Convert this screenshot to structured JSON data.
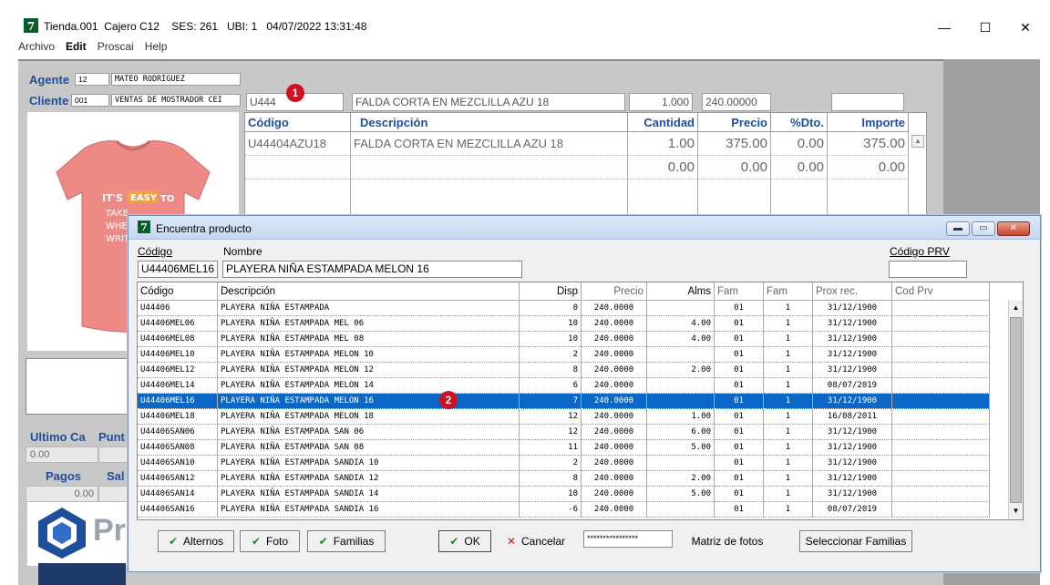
{
  "window": {
    "app_icon": "7",
    "title": "Tienda.001  Cajero C12    SES: 261   UBI: 1   04/07/2022 13:31:48",
    "minimize": "—",
    "maximize": "☐",
    "close": "✕"
  },
  "menu": [
    "Archivo",
    "Edit",
    "Proscai",
    "Help"
  ],
  "customer": {
    "agente_label": "Agente",
    "agente_code": "12",
    "agente_name": "MATEO RODRIGUEZ",
    "cliente_label": "Cliente",
    "cliente_code": "001",
    "cliente_name": "VENTAS DE MOSTRADOR CEI"
  },
  "entry": {
    "code": "U444",
    "description": "FALDA CORTA EN MEZCLILLA AZU 18",
    "quantity": "1.000",
    "price": "240.00000",
    "extra": ""
  },
  "order_grid": {
    "headers": [
      "Código",
      "Descripción",
      "Cantidad",
      "Precio",
      "%Dto.",
      "Importe"
    ],
    "rows": [
      [
        "U44404AZU18",
        "FALDA CORTA EN MEZCLILLA AZU 18",
        "1.00",
        "375.00",
        "0.00",
        "375.00"
      ],
      [
        "",
        "",
        "0.00",
        "0.00",
        "0.00",
        "0.00"
      ]
    ]
  },
  "side": {
    "ultimo_label": "Ultimo Ca",
    "punto_label": "Punt",
    "ultimo_value": "0.00",
    "pagos_label": "Pagos",
    "saldo_label": "Sal",
    "pagos_value": "0.00",
    "logo_text": "Pr"
  },
  "dialog": {
    "icon": "7",
    "title": "Encuentra producto",
    "codigo_label": "Código",
    "nombre_label": "Nombre",
    "codigo_prv_label": "Código PRV",
    "codigo_value": "U44406MEL16",
    "nombre_value": "PLAYERA NIÑA ESTAMPADA MELON 16",
    "codigo_prv_value": "",
    "columns": [
      "Código",
      "Descripción",
      "Disp",
      "Precio",
      "Alms",
      "Fam",
      "Fam",
      "Prox rec.",
      "Cod Prv"
    ],
    "rows": [
      [
        "U44406",
        "PLAYERA NIÑA ESTAMPADA",
        "0",
        "240.0000",
        "",
        "01",
        "1",
        "31/12/1900",
        ""
      ],
      [
        "U44406MEL06",
        "PLAYERA NIÑA ESTAMPADA MEL 06",
        "10",
        "240.0000",
        "4.00",
        "01",
        "1",
        "31/12/1900",
        ""
      ],
      [
        "U44406MEL08",
        "PLAYERA NIÑA ESTAMPADA MEL 08",
        "10",
        "240.0000",
        "4.00",
        "01",
        "1",
        "31/12/1900",
        ""
      ],
      [
        "U44406MEL10",
        "PLAYERA NIÑA ESTAMPADA MELON 10",
        "2",
        "240.0000",
        "",
        "01",
        "1",
        "31/12/1900",
        ""
      ],
      [
        "U44406MEL12",
        "PLAYERA NIÑA ESTAMPADA MELON 12",
        "8",
        "240.0000",
        "2.00",
        "01",
        "1",
        "31/12/1900",
        ""
      ],
      [
        "U44406MEL14",
        "PLAYERA NIÑA ESTAMPADA MELON 14",
        "6",
        "240.0000",
        "",
        "01",
        "1",
        "08/07/2019",
        ""
      ],
      [
        "U44406MEL16",
        "PLAYERA NIÑA ESTAMPADA MELON 16",
        "7",
        "240.0000",
        "",
        "01",
        "1",
        "31/12/1900",
        ""
      ],
      [
        "U44406MEL18",
        "PLAYERA NIÑA ESTAMPADA MELON 18",
        "12",
        "240.0000",
        "1.00",
        "01",
        "1",
        "16/08/2011",
        ""
      ],
      [
        "U44406SAN06",
        "PLAYERA NIÑA ESTAMPADA SAN 06",
        "12",
        "240.0000",
        "6.00",
        "01",
        "1",
        "31/12/1900",
        ""
      ],
      [
        "U44406SAN08",
        "PLAYERA NIÑA ESTAMPADA SAN 08",
        "11",
        "240.0000",
        "5.00",
        "01",
        "1",
        "31/12/1900",
        ""
      ],
      [
        "U44406SAN10",
        "PLAYERA NIÑA ESTAMPADA SANDIA 10",
        "2",
        "240.0000",
        "",
        "01",
        "1",
        "31/12/1900",
        ""
      ],
      [
        "U44406SAN12",
        "PLAYERA NIÑA ESTAMPADA SANDIA 12",
        "8",
        "240.0000",
        "2.00",
        "01",
        "1",
        "31/12/1900",
        ""
      ],
      [
        "U44406SAN14",
        "PLAYERA NIÑA ESTAMPADA SANDIA 14",
        "10",
        "240.0000",
        "5.00",
        "01",
        "1",
        "31/12/1900",
        ""
      ],
      [
        "U44406SAN16",
        "PLAYERA NIÑA ESTAMPADA SANDIA 16",
        "-6",
        "240.0000",
        "",
        "01",
        "1",
        "08/07/2019",
        ""
      ]
    ],
    "selected_row": 6,
    "buttons": {
      "alternos": "Alternos",
      "foto": "Foto",
      "familias": "Familias",
      "ok": "OK",
      "cancelar": "Cancelar",
      "password": "****************",
      "matriz": "Matriz de fotos",
      "seleccionar": "Seleccionar Familias"
    }
  },
  "badges": {
    "one": "1",
    "two": "2"
  },
  "colors": {
    "accent": "#1f4e9a",
    "selection": "#0a67c5",
    "badge": "#d0101e"
  }
}
